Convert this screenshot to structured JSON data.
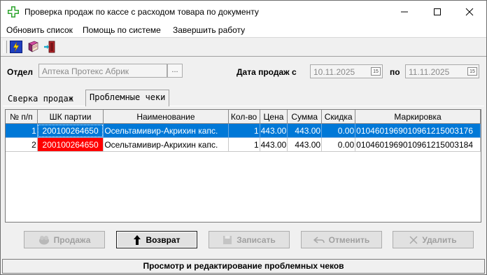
{
  "window": {
    "title": "Проверка продаж по кассе с расходом товара по документу"
  },
  "menu": [
    "Обновить список",
    "Помощь по системе",
    "Завершить работу"
  ],
  "toolbar": {
    "icons": [
      "lightning-icon",
      "book-icon",
      "exit-door-icon"
    ]
  },
  "filters": {
    "department_label": "Отдел",
    "department_value": "Аптека Протекс Абрик",
    "department_button": "...",
    "date_label": "Дата продаж с",
    "date_from": "10.11.2025",
    "date_to_label": "по",
    "date_to": "11.11.2025",
    "calendar_glyph": "15"
  },
  "tabs": [
    {
      "label": "Сверка продаж",
      "active": false
    },
    {
      "label": "Проблемные чеки",
      "active": true
    }
  ],
  "table": {
    "columns": [
      "№ п/п",
      "ШК партии",
      "Наименование",
      "Кол-во",
      "Цена",
      "Сумма",
      "Скидка",
      "Маркировка"
    ],
    "rows": [
      [
        "1",
        "200100264650",
        "Осельтамивир-Акрихин капс.",
        "1",
        "443.00",
        "443.00",
        "0.00",
        "0104601969010961215003176"
      ],
      [
        "2",
        "200100264650",
        "Осельтамивир-Акрихин капс.",
        "1",
        "443.00",
        "443.00",
        "0.00",
        "0104601969010961215003184"
      ]
    ]
  },
  "buttons": {
    "sale": "Продажа",
    "return": "Возврат",
    "save": "Записать",
    "cancel": "Отменить",
    "delete": "Удалить"
  },
  "status": "Просмотр и редактирование проблемных чеков",
  "colors": {
    "selection": "#0078d7",
    "problem_cell": "#ff0000",
    "app_icon": "#2fa52f"
  }
}
